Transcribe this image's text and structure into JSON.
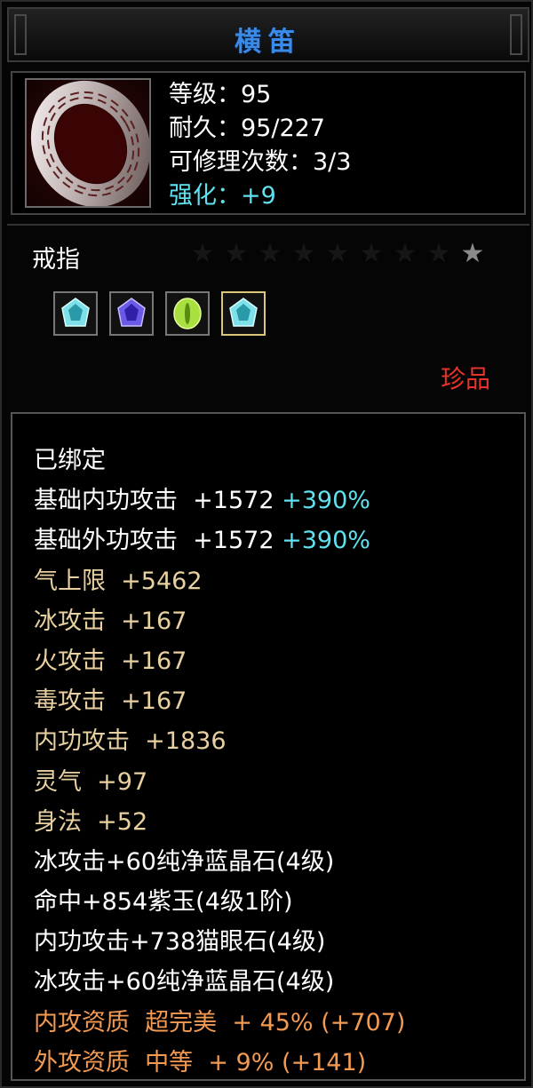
{
  "item": {
    "name": "横笛",
    "level_line": "等级：95",
    "durability_line": "耐久：95/227",
    "repair_line": "可修理次数：3/3",
    "enhance_line": "强化：+9",
    "type": "戒指",
    "rarity": "珍品",
    "stars_total": 9,
    "stars_lit": 1
  },
  "gems": [
    {
      "name": "cyan-crystal",
      "color": "#7ee0e8"
    },
    {
      "name": "purple-jade",
      "color": "#6a5ae8"
    },
    {
      "name": "cats-eye",
      "color": "#a8e040"
    },
    {
      "name": "cyan-crystal",
      "color": "#7ee0e8"
    }
  ],
  "attributes": {
    "bound": "已绑定",
    "base_inner_attack_label": "基础内功攻击  +1572",
    "base_inner_attack_pct": "+390%",
    "base_outer_attack_label": "基础外功攻击  +1572",
    "base_outer_attack_pct": "+390%",
    "lines": [
      "气上限  +5462",
      "冰攻击  +167",
      "火攻击  +167",
      "毒攻击  +167",
      "内功攻击  +1836",
      "灵气  +97",
      "身法  +52"
    ],
    "gem_lines": [
      "冰攻击+60纯净蓝晶石(4级)",
      "命中+854紫玉(4级1阶)",
      "内功攻击+738猫眼石(4级)",
      "冰攻击+60纯净蓝晶石(4级)"
    ],
    "quality_lines": [
      "内攻资质  超完美  + 45% (+707)",
      "外攻资质  中等  + 9% (+141)"
    ]
  },
  "colors": {
    "title": "#3a8ae8",
    "cyan": "#5fe1f0",
    "gold": "#e8d0a0",
    "orange": "#f39a52",
    "rarity": "#e8322a"
  }
}
